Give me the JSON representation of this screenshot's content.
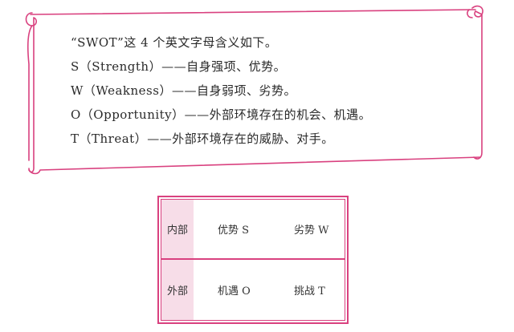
{
  "scroll": {
    "lines": [
      "“SWOT”这 4 个英文字母含义如下。",
      "S（Strength）——自身强项、优势。",
      "W（Weakness）——自身弱项、劣势。",
      "O（Opportunity）——外部环境存在的机会、机遇。",
      "T（Threat）——外部环境存在的威胁、对手。"
    ]
  },
  "table": {
    "rows": [
      {
        "label": "内部",
        "cells": [
          "优势 S",
          "劣势 W"
        ]
      },
      {
        "label": "外部",
        "cells": [
          "机遇 O",
          "挑战 T"
        ]
      }
    ]
  },
  "colors": {
    "accent": "#d9417f",
    "header_fill": "#f7dde8",
    "text": "#2a2a2a"
  }
}
